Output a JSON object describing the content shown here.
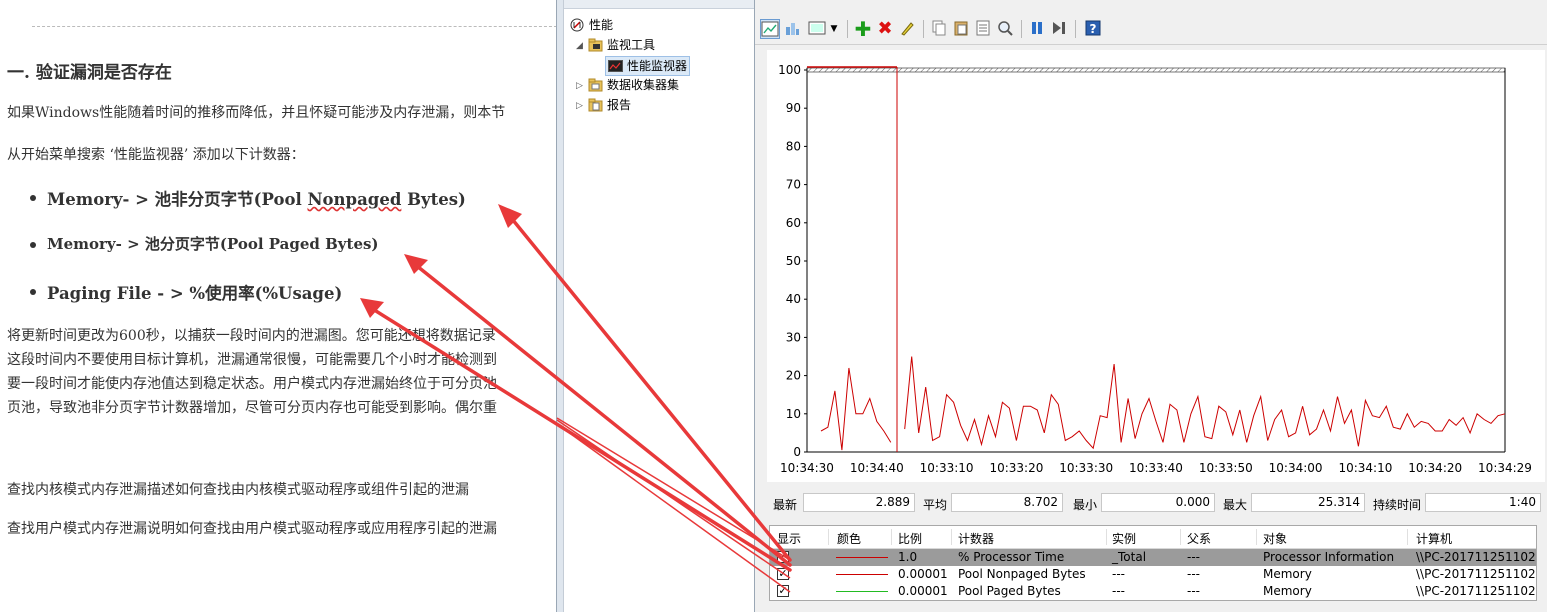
{
  "article": {
    "heading": "一. 验证漏洞是否存在",
    "p1": "如果Windows性能随着时间的推移而降低，并且怀疑可能涉及内存泄漏，则本节",
    "p2": "从开始菜单搜索 ‘性能监视器’ 添加以下计数器：",
    "bullets": [
      {
        "pre": "Memory- > 池非分页字节(Pool ",
        "wavy": "Nonpaged",
        "post": " Bytes)"
      },
      {
        "pre": "Memory- > 池分页字节(Pool Paged Bytes)",
        "wavy": "",
        "post": ""
      },
      {
        "pre": "Paging File - > %使用率(%Usage)",
        "wavy": "",
        "post": ""
      }
    ],
    "para_lines": [
      "将更新时间更改为600秒，以捕获一段时间内的泄漏图。您可能还想将数据记录",
      "这段时间内不要使用目标计算机，泄漏通常很慢，可能需要几个小时才能检测到",
      "要一段时间才能使内存池值达到稳定状态。用户模式内存泄漏始终位于可分页池",
      "页池，导致池非分页字节计数器增加，尽管可分页内存也可能受到影响。偶尔重"
    ],
    "p_kernel": "查找内核模式内存泄漏描述如何查找由内核模式驱动程序或组件引起的泄漏",
    "p_user": "查找用户模式内存泄漏说明如何查找由用户模式驱动程序或应用程序引起的泄漏"
  },
  "tree": {
    "root": "性能",
    "monitoring_tools": "监视工具",
    "perf_monitor": "性能监视器",
    "data_collector_sets": "数据收集器集",
    "reports": "报告"
  },
  "toolbar": {
    "icons": [
      "view-graph-icon",
      "view-histogram-icon",
      "change-graph-type-icon",
      "dropdown-icon",
      "add-counter-icon",
      "delete-counter-icon",
      "highlight-icon",
      "copy-properties-icon",
      "paste-counter-list-icon",
      "properties-icon",
      "zoom-icon",
      "freeze-display-icon",
      "update-data-icon",
      "help-icon"
    ]
  },
  "chart_data": {
    "type": "line",
    "ylim": [
      0,
      100
    ],
    "y_ticks": [
      "0",
      "10",
      "20",
      "30",
      "40",
      "50",
      "60",
      "70",
      "80",
      "90",
      "100"
    ],
    "x_ticks": [
      "10:34:30",
      "10:34:40",
      "10:33:10",
      "10:33:20",
      "10:33:30",
      "10:33:40",
      "10:33:50",
      "10:34:00",
      "10:34:10",
      "10:34:20",
      "10:34:29"
    ],
    "grid": false,
    "series": [
      {
        "name": "% Processor Time",
        "color": "#cc0000",
        "values": [
          8,
          null,
          5.5,
          6.5,
          16,
          0.5,
          22,
          10,
          10,
          14,
          8,
          5.5,
          2.5,
          null,
          6,
          25,
          5,
          17,
          3,
          4,
          15,
          13,
          7,
          3,
          8.5,
          2,
          9.5,
          4,
          13,
          11.5,
          3,
          12,
          12,
          11,
          5,
          15,
          12.5,
          3,
          4,
          5.5,
          3,
          1,
          9.5,
          9,
          23,
          2.5,
          14,
          3.5,
          10,
          14,
          8,
          2.5,
          12.5,
          11,
          2.5,
          10,
          14.5,
          4,
          3.5,
          12,
          10.5,
          4.5,
          11,
          2.5,
          9.5,
          14.5,
          3,
          8.5,
          11,
          4,
          5,
          12,
          4.5,
          6,
          11,
          5.5,
          14.5,
          7.5,
          11,
          1.5,
          13.5,
          9.5,
          9,
          12,
          6.5,
          6,
          10,
          6.5,
          8,
          7.5,
          5.5,
          5.5,
          8.5,
          7,
          9,
          5,
          10,
          8.5,
          7.5,
          9.5,
          10
        ]
      }
    ]
  },
  "stats": {
    "last_label": "最新",
    "last_value": "2.889",
    "avg_label": "平均",
    "avg_value": "8.702",
    "min_label": "最小",
    "min_value": "0.000",
    "max_label": "最大",
    "max_value": "25.314",
    "dur_label": "持续时间",
    "dur_value": "1:40"
  },
  "counter_table": {
    "headers": [
      "显示",
      "颜色",
      "比例",
      "计数器",
      "实例",
      "父系",
      "对象",
      "计算机"
    ],
    "rows": [
      {
        "show": "✓",
        "color": "#cc0000",
        "scale": "1.0",
        "counter": "% Processor Time",
        "instance": "_Total",
        "parent": "---",
        "object": "Processor Information",
        "computer": "\\\\PC-201711251102"
      },
      {
        "show": "✓",
        "color": "#cc0000",
        "scale": "0.00001",
        "counter": "Pool Nonpaged Bytes",
        "instance": "---",
        "parent": "---",
        "object": "Memory",
        "computer": "\\\\PC-201711251102"
      },
      {
        "show": "✓",
        "color": "#22bb22",
        "scale": "0.00001",
        "counter": "Pool Paged Bytes",
        "instance": "---",
        "parent": "---",
        "object": "Memory",
        "computer": "\\\\PC-201711251102"
      }
    ]
  },
  "colors": {
    "annotation_arrow": "#e8393a",
    "series_red": "#cc0000",
    "series_green": "#22bb22"
  }
}
